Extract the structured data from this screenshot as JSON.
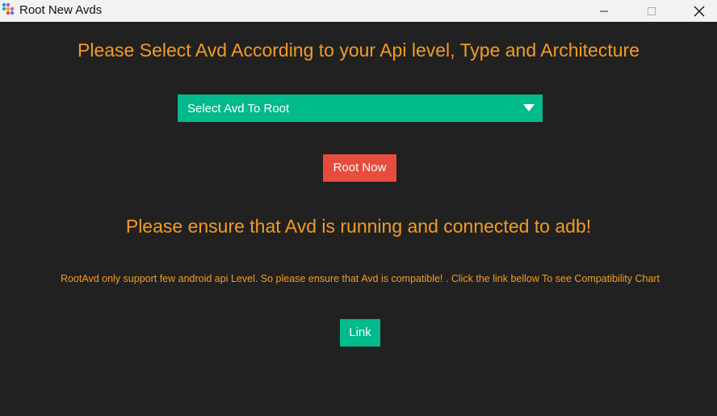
{
  "window": {
    "title": "Root New Avds"
  },
  "main": {
    "heading": "Please Select Avd According to your Api level, Type and Architecture",
    "avd_select": {
      "value": "Select Avd To Root"
    },
    "root_button_label": "Root Now",
    "notice": "Please ensure that Avd is running and connected to adb!",
    "info": "RootAvd only support few android api Level. So please ensure that Avd is compatible! . Click the link bellow To see Compatibility Chart",
    "link_button_label": "Link"
  },
  "colors": {
    "background": "#212121",
    "title_bar": "#f0f3ef",
    "text_accent": "#f29b24",
    "green_button": "#00ba8c",
    "red_button": "#e74c3c"
  },
  "icons": {
    "app": "app-dots-icon",
    "minimize": "minimize-icon",
    "maximize": "maximize-icon",
    "close": "close-icon",
    "dropdown": "dropdown-arrow-icon"
  }
}
